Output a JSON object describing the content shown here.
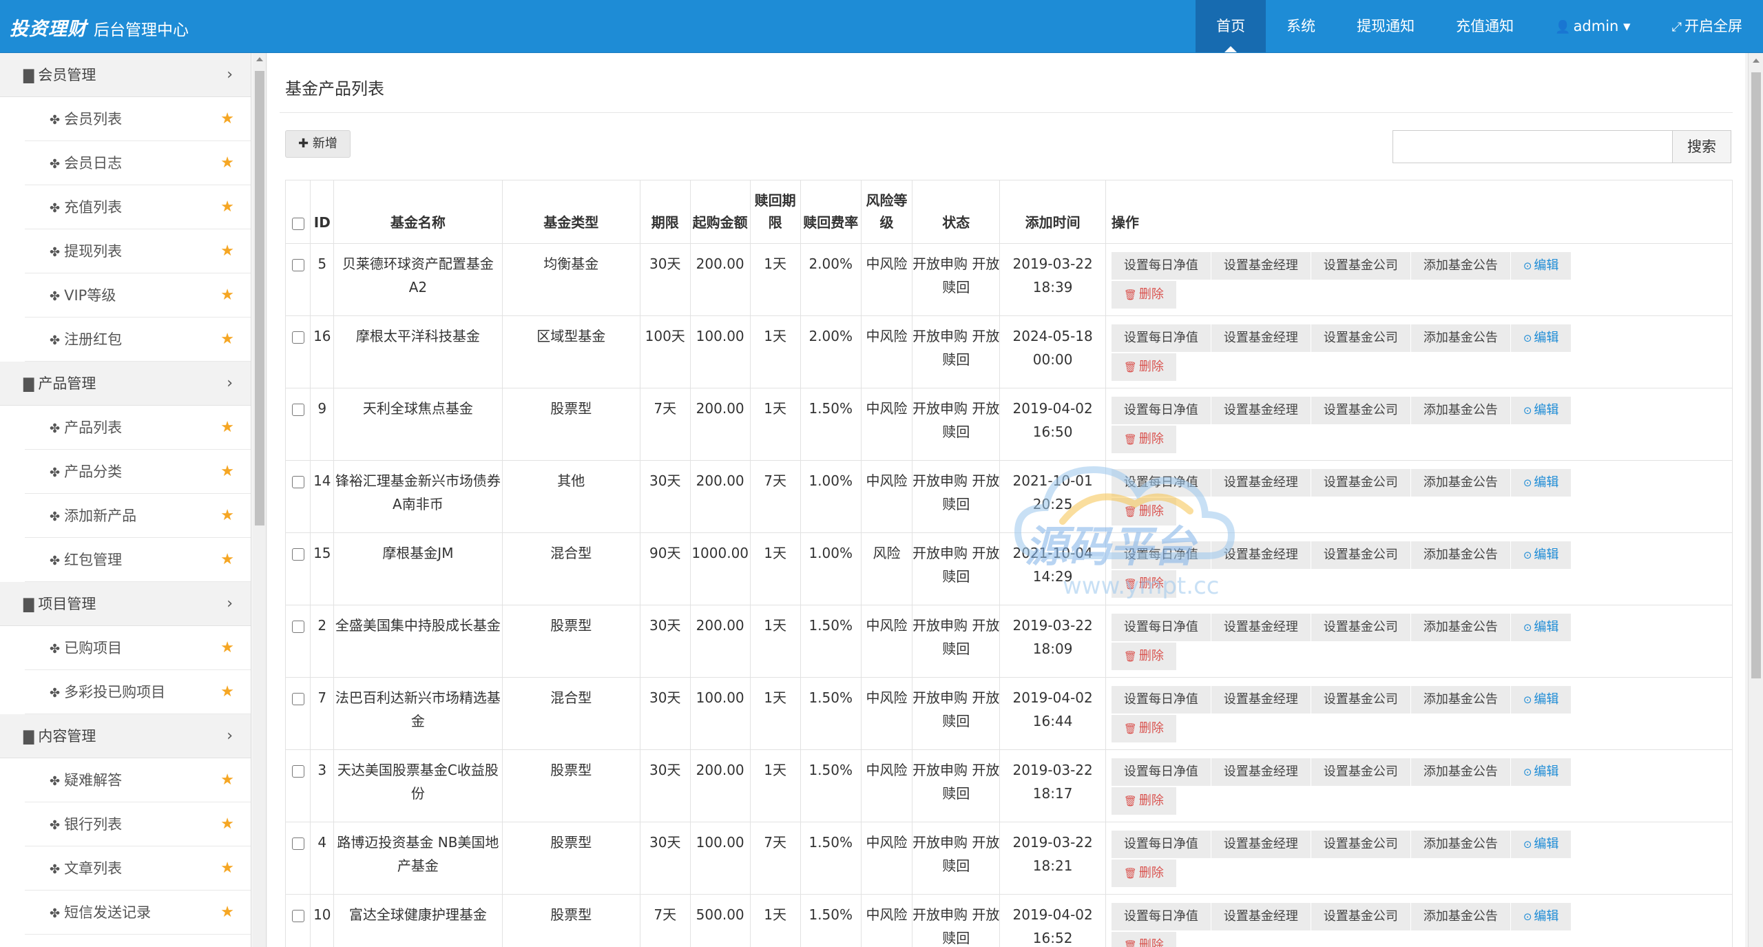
{
  "brand": {
    "name": "投资理财",
    "subtitle": "后台管理中心"
  },
  "nav": [
    {
      "label": "首页",
      "active": true
    },
    {
      "label": "系统"
    },
    {
      "label": "提现通知"
    },
    {
      "label": "充值通知"
    },
    {
      "label": "admin",
      "icon": "user-icon",
      "dropdown": true
    },
    {
      "label": "开启全屏",
      "icon": "fullscreen-icon"
    }
  ],
  "sidebar": [
    {
      "label": "会员管理",
      "items": [
        "会员列表",
        "会员日志",
        "充值列表",
        "提现列表",
        "VIP等级",
        "注册红包"
      ]
    },
    {
      "label": "产品管理",
      "items": [
        "产品列表",
        "产品分类",
        "添加新产品",
        "红包管理"
      ]
    },
    {
      "label": "项目管理",
      "items": [
        "已购项目",
        "多彩投已购项目"
      ]
    },
    {
      "label": "内容管理",
      "items": [
        "疑难解答",
        "银行列表",
        "文章列表",
        "短信发送记录"
      ]
    }
  ],
  "page": {
    "title": "基金产品列表",
    "add_label": "新增",
    "search_placeholder": "",
    "search_label": "搜索"
  },
  "table": {
    "headers": [
      "ID",
      "基金名称",
      "基金类型",
      "期限",
      "起购金额",
      "赎回期限",
      "赎回费率",
      "风险等级",
      "状态",
      "添加时间",
      "操作"
    ],
    "actions": [
      "设置每日净值",
      "设置基金经理",
      "设置基金公司",
      "添加基金公告",
      "编辑",
      "删除"
    ],
    "rows": [
      {
        "id": "5",
        "name": "贝莱德环球资产配置基金A2",
        "type": "均衡基金",
        "term": "30天",
        "min": "200.00",
        "redeem": "1天",
        "fee": "2.00%",
        "risk": "中风险",
        "status": "开放申购 开放赎回",
        "date": "2019-03-22",
        "time": "18:39"
      },
      {
        "id": "16",
        "name": "摩根太平洋科技基金",
        "type": "区域型基金",
        "term": "100天",
        "min": "100.00",
        "redeem": "1天",
        "fee": "2.00%",
        "risk": "中风险",
        "status": "开放申购 开放赎回",
        "date": "2024-05-18",
        "time": "00:00"
      },
      {
        "id": "9",
        "name": "天利全球焦点基金",
        "type": "股票型",
        "term": "7天",
        "min": "200.00",
        "redeem": "1天",
        "fee": "1.50%",
        "risk": "中风险",
        "status": "开放申购 开放赎回",
        "date": "2019-04-02",
        "time": "16:50"
      },
      {
        "id": "14",
        "name": "锋裕汇理基金新兴市场债券A南非币",
        "type": "其他",
        "term": "30天",
        "min": "200.00",
        "redeem": "7天",
        "fee": "1.00%",
        "risk": "中风险",
        "status": "开放申购 开放赎回",
        "date": "2021-10-01",
        "time": "20:25"
      },
      {
        "id": "15",
        "name": "摩根基金JM",
        "type": "混合型",
        "term": "90天",
        "min": "1000.00",
        "redeem": "1天",
        "fee": "1.00%",
        "risk": "风险",
        "status": "开放申购 开放赎回",
        "date": "2021-10-04",
        "time": "14:29"
      },
      {
        "id": "2",
        "name": "全盛美国集中持股成长基金",
        "type": "股票型",
        "term": "30天",
        "min": "200.00",
        "redeem": "1天",
        "fee": "1.50%",
        "risk": "中风险",
        "status": "开放申购 开放赎回",
        "date": "2019-03-22",
        "time": "18:09"
      },
      {
        "id": "7",
        "name": "法巴百利达新兴市场精选基金",
        "type": "混合型",
        "term": "30天",
        "min": "100.00",
        "redeem": "1天",
        "fee": "1.50%",
        "risk": "中风险",
        "status": "开放申购 开放赎回",
        "date": "2019-04-02",
        "time": "16:44"
      },
      {
        "id": "3",
        "name": "天达美国股票基金C收益股份",
        "type": "股票型",
        "term": "30天",
        "min": "200.00",
        "redeem": "1天",
        "fee": "1.50%",
        "risk": "中风险",
        "status": "开放申购 开放赎回",
        "date": "2019-03-22",
        "time": "18:17"
      },
      {
        "id": "4",
        "name": "路博迈投资基金 NB美国地产基金",
        "type": "股票型",
        "term": "30天",
        "min": "100.00",
        "redeem": "7天",
        "fee": "1.50%",
        "risk": "中风险",
        "status": "开放申购 开放赎回",
        "date": "2019-03-22",
        "time": "18:21"
      },
      {
        "id": "10",
        "name": "富达全球健康护理基金",
        "type": "股票型",
        "term": "7天",
        "min": "500.00",
        "redeem": "1天",
        "fee": "1.50%",
        "risk": "中风险",
        "status": "开放申购 开放赎回",
        "date": "2019-04-02",
        "time": "16:52"
      }
    ]
  },
  "watermark": {
    "text": "源码平台",
    "url": "www.ympt.cc"
  },
  "colors": {
    "navbar": "#1e8cd6",
    "nav_active": "#176bb0",
    "star": "#f5a623",
    "edit": "#1e8cd6",
    "delete": "#d9534f"
  }
}
